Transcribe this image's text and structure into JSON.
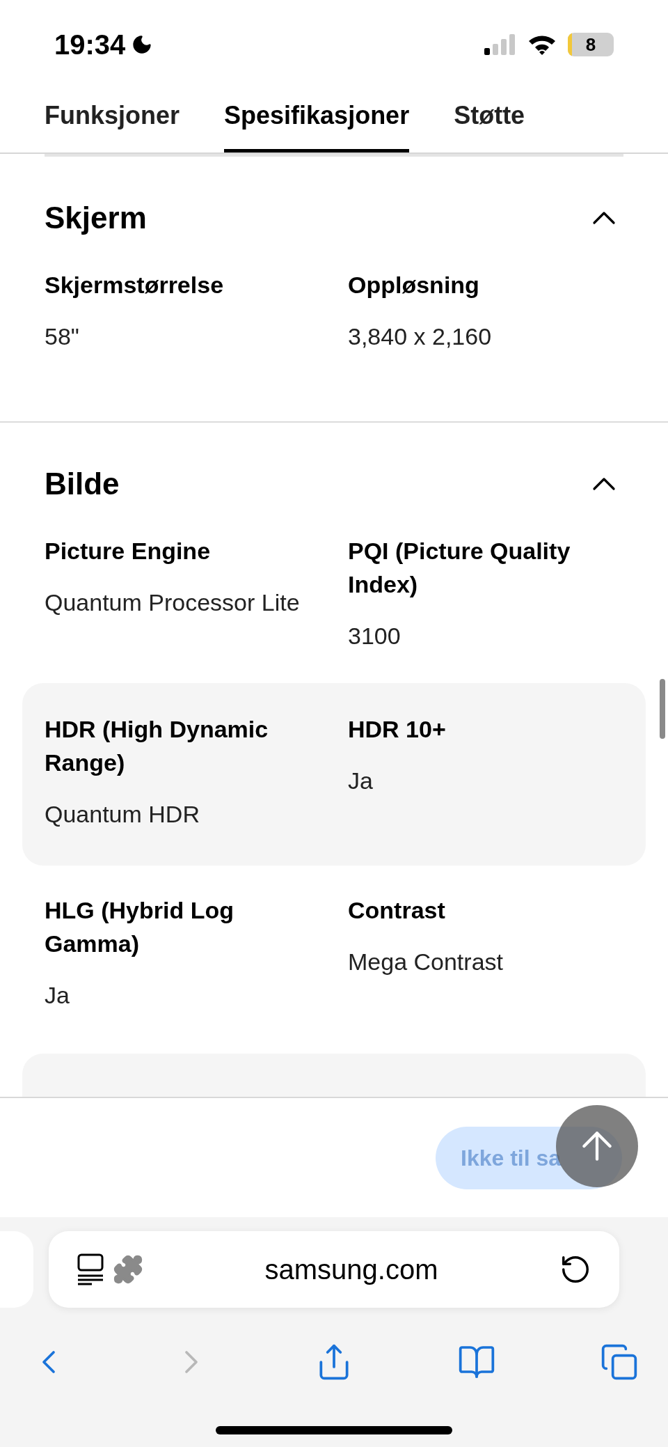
{
  "status_bar": {
    "time": "19:34",
    "battery": "8"
  },
  "tabs": [
    {
      "label": "Funksjoner",
      "selected": false
    },
    {
      "label": "Spesifikasjoner",
      "selected": true
    },
    {
      "label": "Støtte",
      "selected": false
    }
  ],
  "sections": [
    {
      "title": "Skjerm",
      "expanded": true,
      "rows": [
        {
          "shaded": false,
          "items": [
            {
              "label": "Skjermstørrelse",
              "value": "58\""
            },
            {
              "label": "Oppløsning",
              "value": "3,840 x 2,160"
            }
          ]
        }
      ]
    },
    {
      "title": "Bilde",
      "expanded": true,
      "rows": [
        {
          "shaded": false,
          "items": [
            {
              "label": "Picture Engine",
              "value": "Quantum Processor Lite"
            },
            {
              "label": "PQI (Picture Quality Index)",
              "value": "3100"
            }
          ]
        },
        {
          "shaded": true,
          "items": [
            {
              "label": "HDR (High Dynamic Range)",
              "value": "Quantum HDR"
            },
            {
              "label": "HDR 10+",
              "value": "Ja"
            }
          ]
        },
        {
          "shaded": false,
          "items": [
            {
              "label": "HLG (Hybrid Log Gamma)",
              "value": "Ja"
            },
            {
              "label": "Contrast",
              "value": "Mega Contrast"
            }
          ]
        },
        {
          "shaded": true
        }
      ]
    }
  ],
  "purchase_button": {
    "label": "Ikke til sa",
    "disabled": true
  },
  "browser": {
    "url": "samsung.com",
    "nav": [
      {
        "kind": "back",
        "disabled": false
      },
      {
        "kind": "forward",
        "disabled": true
      },
      {
        "kind": "share",
        "disabled": false
      },
      {
        "kind": "bookmarks",
        "disabled": false
      },
      {
        "kind": "tabs",
        "disabled": false
      }
    ]
  }
}
